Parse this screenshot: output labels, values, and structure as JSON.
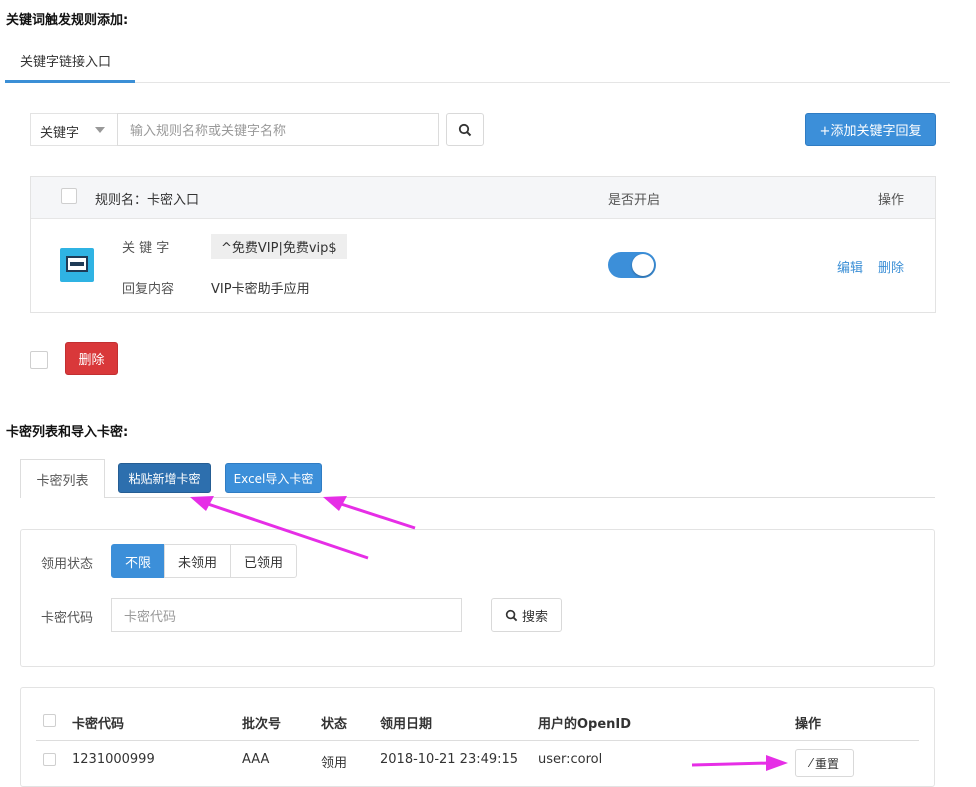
{
  "section1": {
    "heading": "关键词触发规则添加:",
    "tab": "关键字链接入口",
    "search": {
      "type_label": "关键字",
      "placeholder": "输入规则名称或关键字名称"
    },
    "add_button": "+添加关键字回复",
    "table": {
      "rule_header": "规则名：卡密入口",
      "enabled_header": "是否开启",
      "ops_header": "操作",
      "row": {
        "keyword_label": "关 键 字",
        "keyword_value": "^免费VIP|免费vip$",
        "reply_label": "回复内容",
        "reply_value": "VIP卡密助手应用",
        "enabled": true,
        "edit": "编辑",
        "delete": "删除"
      }
    },
    "delete_button": "删除"
  },
  "section2": {
    "heading": "卡密列表和导入卡密:",
    "tab": "卡密列表",
    "paste_button": "粘贴新增卡密",
    "excel_button": "Excel导入卡密",
    "filter": {
      "status_label": "领用状态",
      "status_options": [
        "不限",
        "未领用",
        "已领用"
      ],
      "status_selected": "不限",
      "code_label": "卡密代码",
      "code_placeholder": "卡密代码",
      "search_button": "搜索"
    },
    "table": {
      "columns": [
        "卡密代码",
        "批次号",
        "状态",
        "领用日期",
        "用户的OpenID",
        "操作"
      ],
      "rows": [
        {
          "code": "1231000999",
          "batch": "AAA",
          "status": "领用",
          "date": "2018-10-21 23:49:15",
          "openid": "user:corol",
          "action": "重置"
        }
      ]
    }
  },
  "colors": {
    "accent": "#3c8fd9",
    "danger": "#d9383a",
    "annotation_arrow": "#e62ee6"
  }
}
